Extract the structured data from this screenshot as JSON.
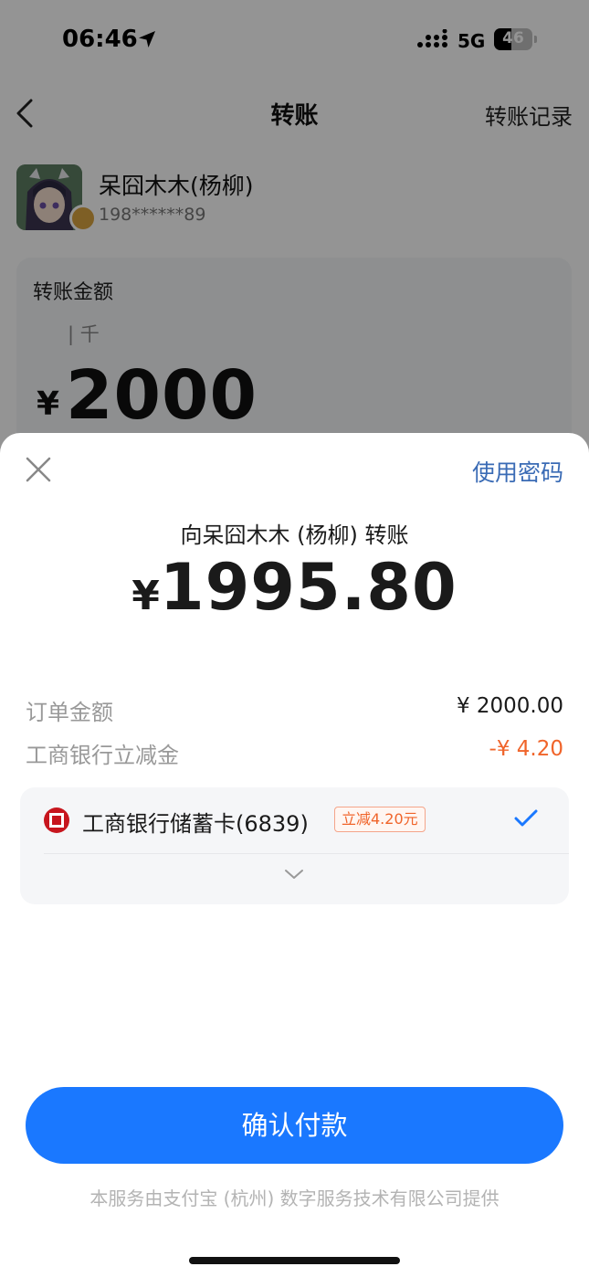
{
  "status_bar": {
    "time": "06:46",
    "network": "5G",
    "battery_level": "46",
    "battery_fraction": 0.46
  },
  "nav": {
    "title": "转账",
    "record_label": "转账记录"
  },
  "payee": {
    "name": "呆囧木木(杨柳)",
    "phone": "198******89"
  },
  "amount_card": {
    "label": "转账金额",
    "unit_hint": "| 千",
    "currency": "¥",
    "value": "2000"
  },
  "sheet": {
    "use_password_label": "使用密码",
    "to_payee": "向呆囧木木 (杨柳) 转账",
    "currency": "¥",
    "pay_amount": "1995.80",
    "rows": [
      {
        "label": "订单金额",
        "value": "¥ 2000.00"
      },
      {
        "label": "工商银行立减金",
        "value": "-¥ 4.20"
      }
    ],
    "method": {
      "bank_name": "工商银行储蓄卡(6839)",
      "promo": "立减4.20元"
    },
    "confirm_label": "确认付款",
    "provider_note": "本服务由支付宝 (杭州) 数字服务技术有限公司提供"
  },
  "colors": {
    "primary_button": "#1a78ff",
    "discount": "#f0642a",
    "link": "#3a6bb5",
    "check": "#1a78ff",
    "bank_red": "#c7161e"
  },
  "icons": [
    "back-arrow-icon",
    "location-arrow-icon",
    "signal-icon",
    "battery-icon",
    "close-icon",
    "bank-logo-icon",
    "checkmark-icon",
    "chevron-down-icon",
    "avatar",
    "badge-icon"
  ]
}
